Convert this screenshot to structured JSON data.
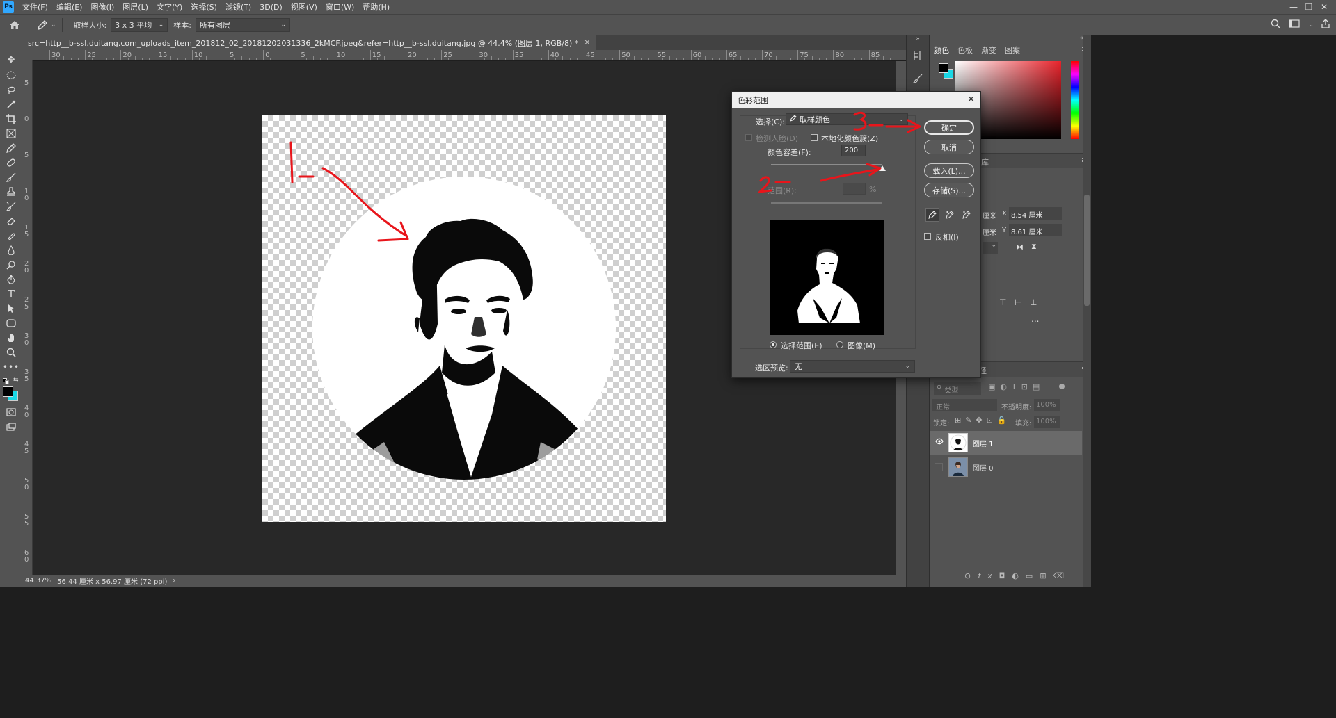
{
  "menubar": {
    "logo": "Ps",
    "items": [
      "文件(F)",
      "编辑(E)",
      "图像(I)",
      "图层(L)",
      "文字(Y)",
      "选择(S)",
      "滤镜(T)",
      "3D(D)",
      "视图(V)",
      "窗口(W)",
      "帮助(H)"
    ],
    "window_controls": [
      "—",
      "❐",
      "✕"
    ]
  },
  "options": {
    "sample_size_label": "取样大小:",
    "sample_size_value": "3 x 3 平均",
    "sample_label": "样本:",
    "sample_value": "所有图层"
  },
  "document": {
    "tab_title": "src=http__b-ssl.duitang.com_uploads_item_201812_02_20181202031336_2kMCF.jpeg&refer=http__b-ssl.duitang.com_uploads_item_201812_02_20181202031336_2kMCF.jpeg@ 44.4% (图层 1, RGB/8) *",
    "tab_title_display": "src=http__b-ssl.duitang.com_uploads_item_201812_02_20181202031336_2kMCF.jpeg&refer=http__b-ssl.duitang.jpg @ 44.4% (图层 1, RGB/8) *",
    "tab_close": "×"
  },
  "ruler": {
    "h_labels": [
      "30",
      "25",
      "20",
      "15",
      "10",
      "5",
      "0",
      "5",
      "10",
      "15",
      "20",
      "25",
      "30",
      "35",
      "40",
      "45",
      "50",
      "55",
      "60",
      "65",
      "70",
      "75",
      "80",
      "85"
    ],
    "v_labels": [
      "5",
      "0",
      "5",
      "1\n0",
      "1\n5",
      "2\n0",
      "2\n5",
      "3\n0",
      "3\n5",
      "4\n0",
      "4\n5",
      "5\n0",
      "5\n5",
      "6\n0"
    ]
  },
  "status": {
    "zoom": "44.37%",
    "size": "56.44 厘米 x 56.97 厘米 (72 ppi)",
    "arrow": "›"
  },
  "panels": {
    "color_tabs": [
      "颜色",
      "色板",
      "渐变",
      "图案"
    ],
    "properties": {
      "x_label": "X",
      "x_value": "8.54 厘米",
      "y_label": "Y",
      "y_value": "8.61 厘米",
      "unit_a": "厘米",
      "unit_b": "厘米",
      "panel_edge_label": "库",
      "more": "..."
    },
    "layers": {
      "paths_tab_fragment": "路径",
      "kind_placeholder": "类型",
      "blend_mode": "正常",
      "opacity_label": "不透明度:",
      "opacity_value": "100%",
      "lock_label": "锁定:",
      "fill_label": "填充:",
      "fill_value": "100%",
      "items": [
        {
          "name": "图层 1",
          "visible": true,
          "selected": true
        },
        {
          "name": "图层 0",
          "visible": false,
          "selected": false
        }
      ]
    }
  },
  "dialog": {
    "title": "色彩范围",
    "close": "✕",
    "select_label": "选择(C):",
    "select_value": "取样颜色",
    "detect_faces": "检测人脸(D)",
    "localized": "本地化颜色簇(Z)",
    "fuzziness_label": "颜色容差(F):",
    "fuzziness_value": "200",
    "fuzziness_fraction": 1.0,
    "range_label": "范围(R):",
    "range_unit": "%",
    "radio_selection": "选择范围(E)",
    "radio_image": "图像(M)",
    "preview_label": "选区预览:",
    "preview_value": "无",
    "ok": "确定",
    "cancel": "取消",
    "load": "载入(L)...",
    "save": "存储(S)...",
    "invert": "反相(I)"
  },
  "annotations": [
    "1",
    "2",
    "3"
  ],
  "colors": {
    "annotation_red": "#e8151b",
    "foreground": "#000000",
    "background": "#19d8e6",
    "bg_dark": "#282828",
    "panel": "#535353"
  }
}
